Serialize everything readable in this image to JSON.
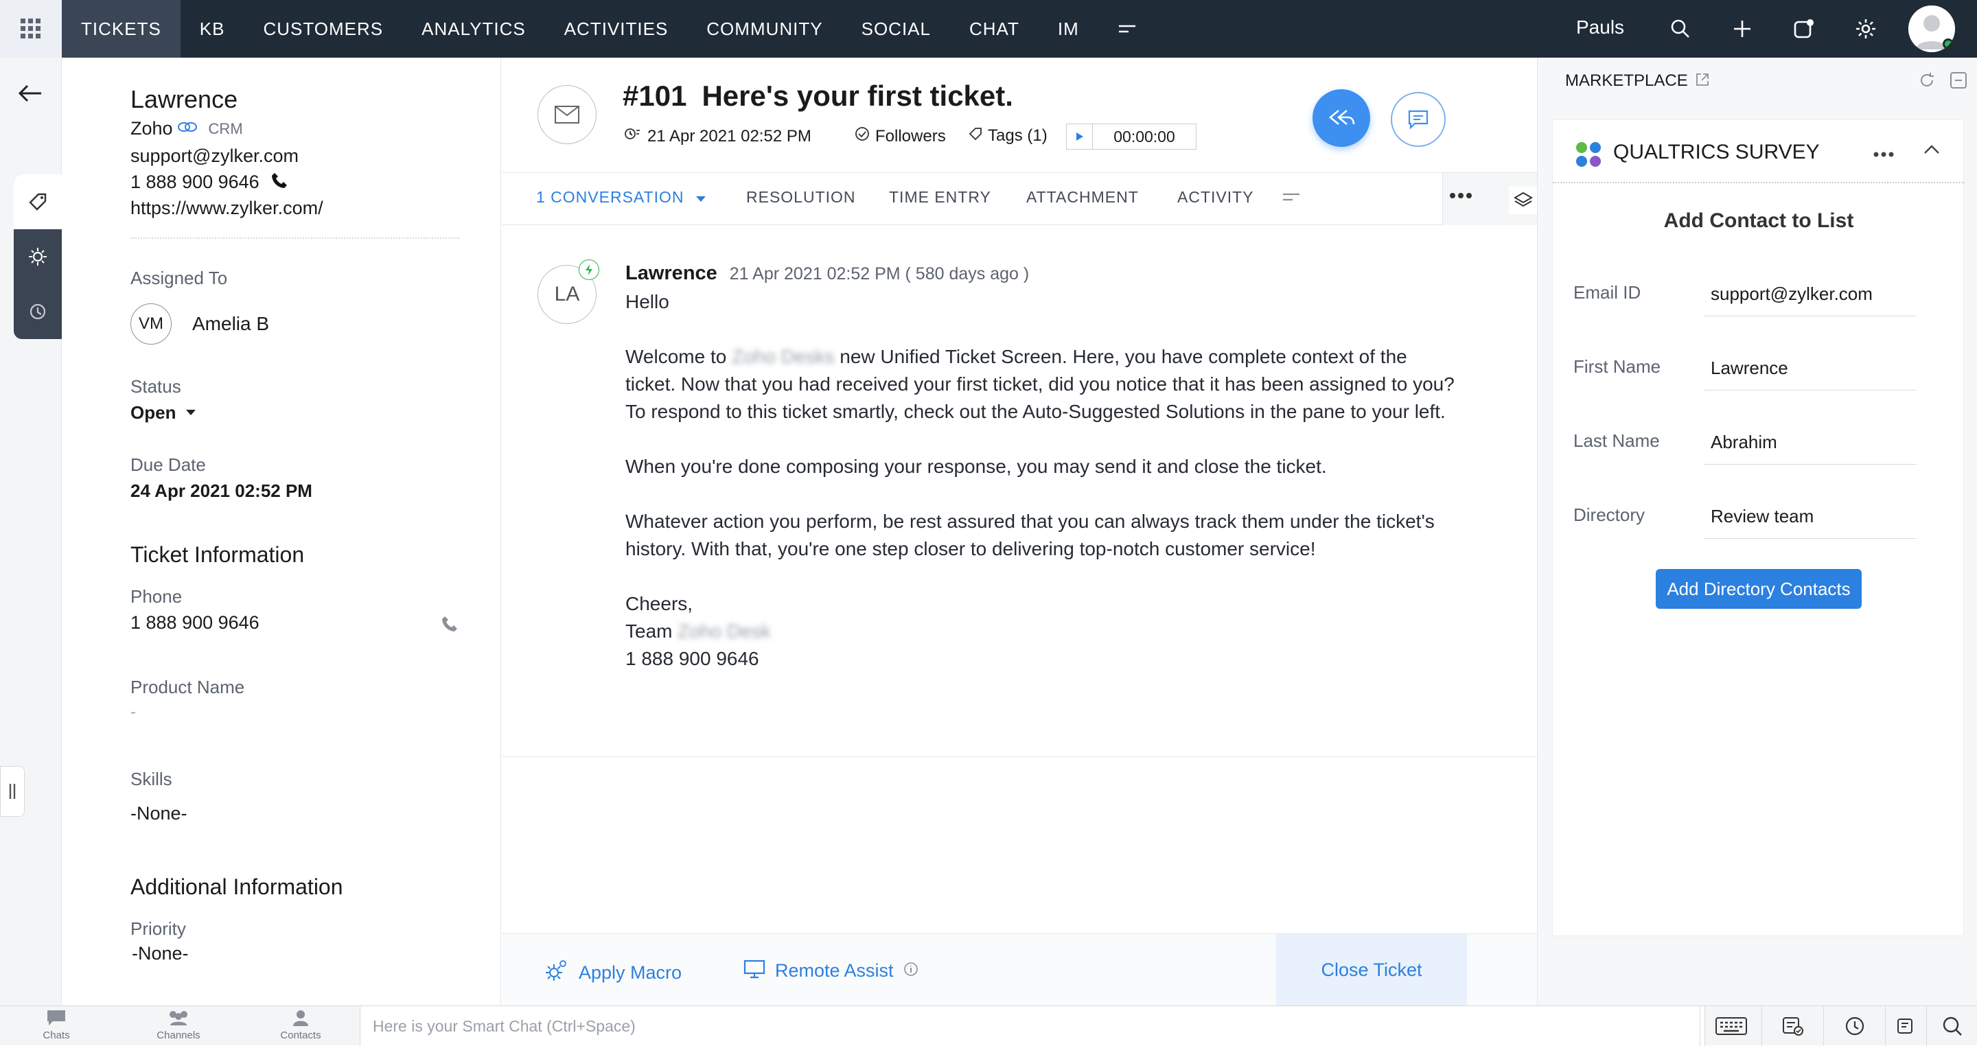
{
  "topnav": {
    "items": [
      "TICKETS",
      "KB",
      "CUSTOMERS",
      "ANALYTICS",
      "ACTIVITIES",
      "COMMUNITY",
      "SOCIAL",
      "CHAT",
      "IM"
    ],
    "user": "Pauls"
  },
  "contact": {
    "name": "Lawrence",
    "crm_brand": "Zoho",
    "crm_label": "CRM",
    "email": "support@zylker.com",
    "phone": "1 888 900 9646",
    "website": "https://www.zylker.com/",
    "assigned_to_label": "Assigned To",
    "assignee_initials": "VM",
    "assignee": "Amelia B",
    "status_label": "Status",
    "status": "Open",
    "due_label": "Due Date",
    "due": "24 Apr 2021 02:52 PM",
    "ticket_info_title": "Ticket Information",
    "phone_label": "Phone",
    "ticket_phone": "1 888 900 9646",
    "product_label": "Product Name",
    "product": "-",
    "skills_label": "Skills",
    "skills": "-None-",
    "additional_title": "Additional Information",
    "priority_label": "Priority",
    "priority": "-None-"
  },
  "ticket": {
    "number": "#101",
    "subject": "Here's your first ticket.",
    "date": "21 Apr 2021 02:52 PM",
    "followers": "Followers",
    "tags": "Tags (1)",
    "timer": "00:00:00",
    "tabs": {
      "conversation": "1 CONVERSATION",
      "resolution": "RESOLUTION",
      "time_entry": "TIME ENTRY",
      "attachment": "ATTACHMENT",
      "activity": "ACTIVITY"
    },
    "message": {
      "initials": "LA",
      "sender": "Lawrence",
      "time": "21 Apr 2021 02:52 PM ( 580 days ago )",
      "greeting": "Hello",
      "p1a_pre": "Welcome to ",
      "p1a_blur": "Zoho Desks",
      "p1a_post": " new Unified Ticket Screen. Here, you have complete context of the",
      "p1b": "ticket. Now that you had received your first ticket, did you notice that it has been assigned to you?",
      "p1c": "To respond to this ticket smartly, check out the Auto-Suggested Solutions in the pane to your left.",
      "p2": "When you're done composing your response, you may send it and close the ticket.",
      "p3a": "Whatever action you perform, be rest assured that you can always track them under the ticket's",
      "p3b": "history. With that, you're one step closer to delivering top-notch customer service!",
      "sign1": "Cheers,",
      "sign2_pre": "Team ",
      "sign2_blur": "Zoho Desk",
      "sign3": "1 888 900 9646"
    },
    "footer": {
      "apply_macro": "Apply Macro",
      "remote_assist": "Remote Assist",
      "close_ticket": "Close Ticket"
    }
  },
  "marketplace": {
    "title": "MARKETPLACE",
    "widget_title": "QUALTRICS SURVEY",
    "form_title": "Add Contact to List",
    "fields": [
      {
        "label": "Email ID",
        "value": "support@zylker.com"
      },
      {
        "label": "First Name",
        "value": "Lawrence"
      },
      {
        "label": "Last Name",
        "value": "Abrahim"
      },
      {
        "label": "Directory",
        "value": "Review team"
      }
    ],
    "button": "Add Directory Contacts"
  },
  "bottombar": {
    "chats": "Chats",
    "channels": "Channels",
    "contacts": "Contacts",
    "smart_chat_placeholder": "Here is your Smart Chat (Ctrl+Space)"
  },
  "colors": {
    "topbar": "#202b38",
    "accent": "#2b80e0",
    "reply_button": "#3d8ff0"
  }
}
